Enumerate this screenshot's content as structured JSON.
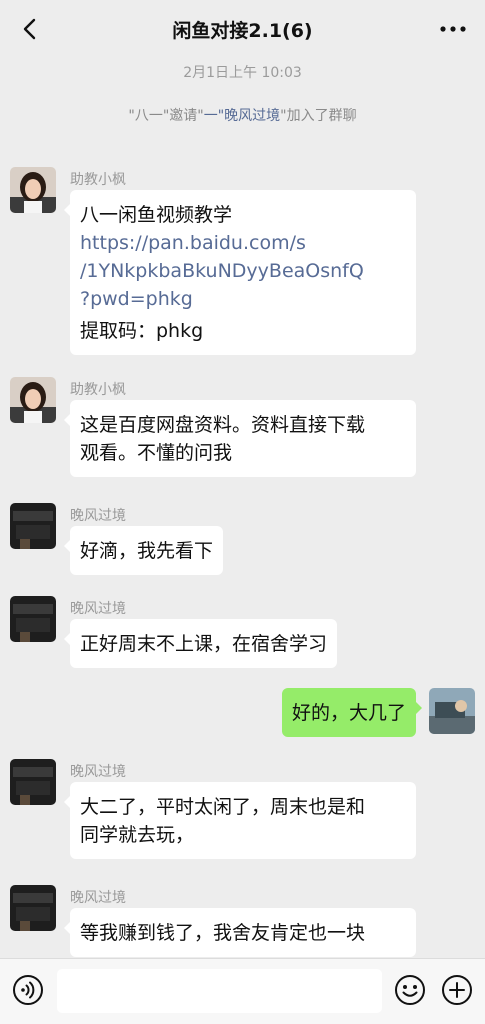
{
  "header": {
    "title": "闲鱼对接2.1(6)"
  },
  "timestamp": "2月1日上午 10:03",
  "system_message": {
    "part1": "\"八一\"邀请\"",
    "name1": "一\"晚风过境",
    "part2": "\"加入了群聊"
  },
  "messages": [
    {
      "sender": "助教小枫",
      "lines": [
        "八一闲鱼视频教学"
      ],
      "url_lines": [
        "https://pan.baidu.com/s",
        "/1YNkpkbaBkuNDyyBeaOsnfQ",
        "?pwd=phkg"
      ],
      "tail": "提取码：phkg"
    },
    {
      "sender": "助教小枫",
      "lines": [
        "这是百度网盘资料。资料直接下载",
        "观看。不懂的问我"
      ]
    },
    {
      "sender": "晚风过境",
      "lines": [
        "好滴，我先看下"
      ]
    },
    {
      "sender": "晚风过境",
      "lines": [
        "正好周末不上课，在宿舍学习"
      ]
    },
    {
      "sender": "me",
      "lines": [
        "好的，大几了"
      ]
    },
    {
      "sender": "晚风过境",
      "lines": [
        "大二了，平时太闲了，周末也是和",
        "同学就去玩，"
      ]
    },
    {
      "sender": "晚风过境",
      "lines": [
        "等我赚到钱了，我舍友肯定也一块"
      ]
    }
  ],
  "colors": {
    "background": "#ededed",
    "self_bubble": "#95ec69",
    "other_bubble": "#ffffff",
    "link": "#576b95"
  },
  "icons": {
    "back": "chevron-left-icon",
    "more": "more-dots-icon",
    "voice": "voice-icon",
    "emoji": "emoji-icon",
    "plus": "plus-icon"
  }
}
